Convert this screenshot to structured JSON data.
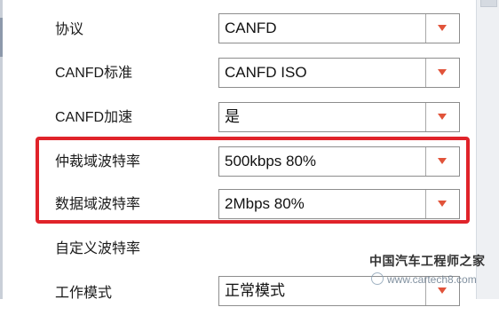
{
  "fields": [
    {
      "label": "协议",
      "value": "CANFD",
      "type": "dropdown"
    },
    {
      "label": "CANFD标准",
      "value": "CANFD ISO",
      "type": "dropdown"
    },
    {
      "label": "CANFD加速",
      "value": "是",
      "type": "dropdown"
    },
    {
      "label": "仲裁域波特率",
      "value": "500kbps 80%",
      "type": "dropdown"
    },
    {
      "label": "数据域波特率",
      "value": "2Mbps 80%",
      "type": "dropdown"
    },
    {
      "label": "自定义波特率",
      "value": "",
      "type": "checkbox-label"
    },
    {
      "label": "工作模式",
      "value": "正常模式",
      "type": "dropdown"
    }
  ],
  "icons": {
    "dropdown_arrow": "triangle-down-icon"
  },
  "colors": {
    "highlight": "#e0232a",
    "arrow": "#e1533a",
    "border": "#8d8d8d"
  },
  "watermark": {
    "title": "中国汽车工程师之家",
    "subtitle": "www.cartech8.com"
  }
}
